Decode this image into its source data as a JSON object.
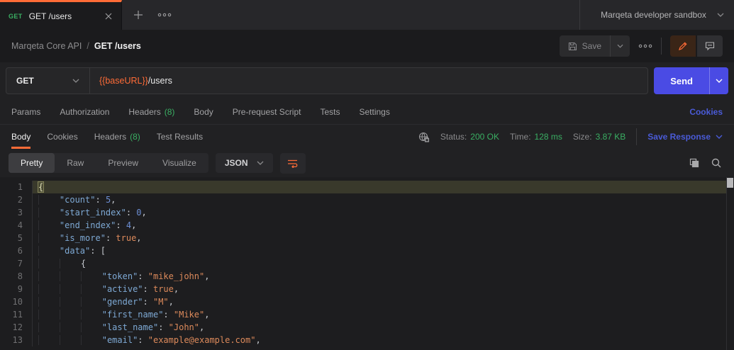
{
  "colors": {
    "accent": "#ff6c37",
    "green": "#3aaf63",
    "link_blue": "#4a5bd8",
    "send_blue": "#4a4be4",
    "key": "#7ea9d4",
    "number": "#6d8fd4",
    "string": "#dd8a5b",
    "boolean": "#dd8a5b",
    "punct": "#c6cad0",
    "line_number": "#707072",
    "highlight_row": "#39392b"
  },
  "tabbar": {
    "tab": {
      "method": "GET",
      "title": "GET /users"
    },
    "environment": "Marqeta developer sandbox"
  },
  "breadcrumb": {
    "collection": "Marqeta Core API",
    "separator": "/",
    "request": "GET /users"
  },
  "actions": {
    "save": "Save"
  },
  "request": {
    "method": "GET",
    "url_variable": "{{baseURL}}",
    "url_path": "/users",
    "send": "Send"
  },
  "request_tabs": [
    {
      "label": "Params"
    },
    {
      "label": "Authorization"
    },
    {
      "label": "Headers",
      "count": "(8)"
    },
    {
      "label": "Body"
    },
    {
      "label": "Pre-request Script"
    },
    {
      "label": "Tests"
    },
    {
      "label": "Settings"
    }
  ],
  "cookies_link": "Cookies",
  "response": {
    "tabs": [
      {
        "label": "Body",
        "active": true
      },
      {
        "label": "Cookies"
      },
      {
        "label": "Headers",
        "count": "(8)"
      },
      {
        "label": "Test Results"
      }
    ],
    "meta": {
      "status_label": "Status:",
      "status_value": "200 OK",
      "time_label": "Time:",
      "time_value": "128 ms",
      "size_label": "Size:",
      "size_value": "3.87 KB",
      "save_response": "Save Response"
    },
    "view_modes": [
      {
        "label": "Pretty",
        "active": true
      },
      {
        "label": "Raw"
      },
      {
        "label": "Preview"
      },
      {
        "label": "Visualize"
      }
    ],
    "format": "JSON"
  },
  "icons": [
    "close-icon",
    "plus-icon",
    "more-icon",
    "chevron-down-icon",
    "save-icon",
    "pencil-icon",
    "comment-icon",
    "network-lock-icon",
    "wrap-text-icon",
    "copy-icon",
    "search-icon"
  ],
  "code": {
    "lines": [
      {
        "n": 1,
        "indent": 0,
        "highlight": true,
        "tokens": [
          {
            "t": "bracket",
            "v": "{"
          }
        ]
      },
      {
        "n": 2,
        "indent": 1,
        "tokens": [
          {
            "t": "key",
            "v": "\"count\""
          },
          {
            "t": "punct",
            "v": ": "
          },
          {
            "t": "num",
            "v": "5"
          },
          {
            "t": "punct",
            "v": ","
          }
        ]
      },
      {
        "n": 3,
        "indent": 1,
        "tokens": [
          {
            "t": "key",
            "v": "\"start_index\""
          },
          {
            "t": "punct",
            "v": ": "
          },
          {
            "t": "num",
            "v": "0"
          },
          {
            "t": "punct",
            "v": ","
          }
        ]
      },
      {
        "n": 4,
        "indent": 1,
        "tokens": [
          {
            "t": "key",
            "v": "\"end_index\""
          },
          {
            "t": "punct",
            "v": ": "
          },
          {
            "t": "num",
            "v": "4"
          },
          {
            "t": "punct",
            "v": ","
          }
        ]
      },
      {
        "n": 5,
        "indent": 1,
        "tokens": [
          {
            "t": "key",
            "v": "\"is_more\""
          },
          {
            "t": "punct",
            "v": ": "
          },
          {
            "t": "bool",
            "v": "true"
          },
          {
            "t": "punct",
            "v": ","
          }
        ]
      },
      {
        "n": 6,
        "indent": 1,
        "tokens": [
          {
            "t": "key",
            "v": "\"data\""
          },
          {
            "t": "punct",
            "v": ": ["
          }
        ]
      },
      {
        "n": 7,
        "indent": 2,
        "tokens": [
          {
            "t": "punct",
            "v": "{"
          }
        ]
      },
      {
        "n": 8,
        "indent": 3,
        "tokens": [
          {
            "t": "key",
            "v": "\"token\""
          },
          {
            "t": "punct",
            "v": ": "
          },
          {
            "t": "str",
            "v": "\"mike_john\""
          },
          {
            "t": "punct",
            "v": ","
          }
        ]
      },
      {
        "n": 9,
        "indent": 3,
        "tokens": [
          {
            "t": "key",
            "v": "\"active\""
          },
          {
            "t": "punct",
            "v": ": "
          },
          {
            "t": "bool",
            "v": "true"
          },
          {
            "t": "punct",
            "v": ","
          }
        ]
      },
      {
        "n": 10,
        "indent": 3,
        "tokens": [
          {
            "t": "key",
            "v": "\"gender\""
          },
          {
            "t": "punct",
            "v": ": "
          },
          {
            "t": "str",
            "v": "\"M\""
          },
          {
            "t": "punct",
            "v": ","
          }
        ]
      },
      {
        "n": 11,
        "indent": 3,
        "tokens": [
          {
            "t": "key",
            "v": "\"first_name\""
          },
          {
            "t": "punct",
            "v": ": "
          },
          {
            "t": "str",
            "v": "\"Mike\""
          },
          {
            "t": "punct",
            "v": ","
          }
        ]
      },
      {
        "n": 12,
        "indent": 3,
        "tokens": [
          {
            "t": "key",
            "v": "\"last_name\""
          },
          {
            "t": "punct",
            "v": ": "
          },
          {
            "t": "str",
            "v": "\"John\""
          },
          {
            "t": "punct",
            "v": ","
          }
        ]
      },
      {
        "n": 13,
        "indent": 3,
        "tokens": [
          {
            "t": "key",
            "v": "\"email\""
          },
          {
            "t": "punct",
            "v": ": "
          },
          {
            "t": "str",
            "v": "\"example@example.com\""
          },
          {
            "t": "punct",
            "v": ","
          }
        ]
      }
    ]
  }
}
